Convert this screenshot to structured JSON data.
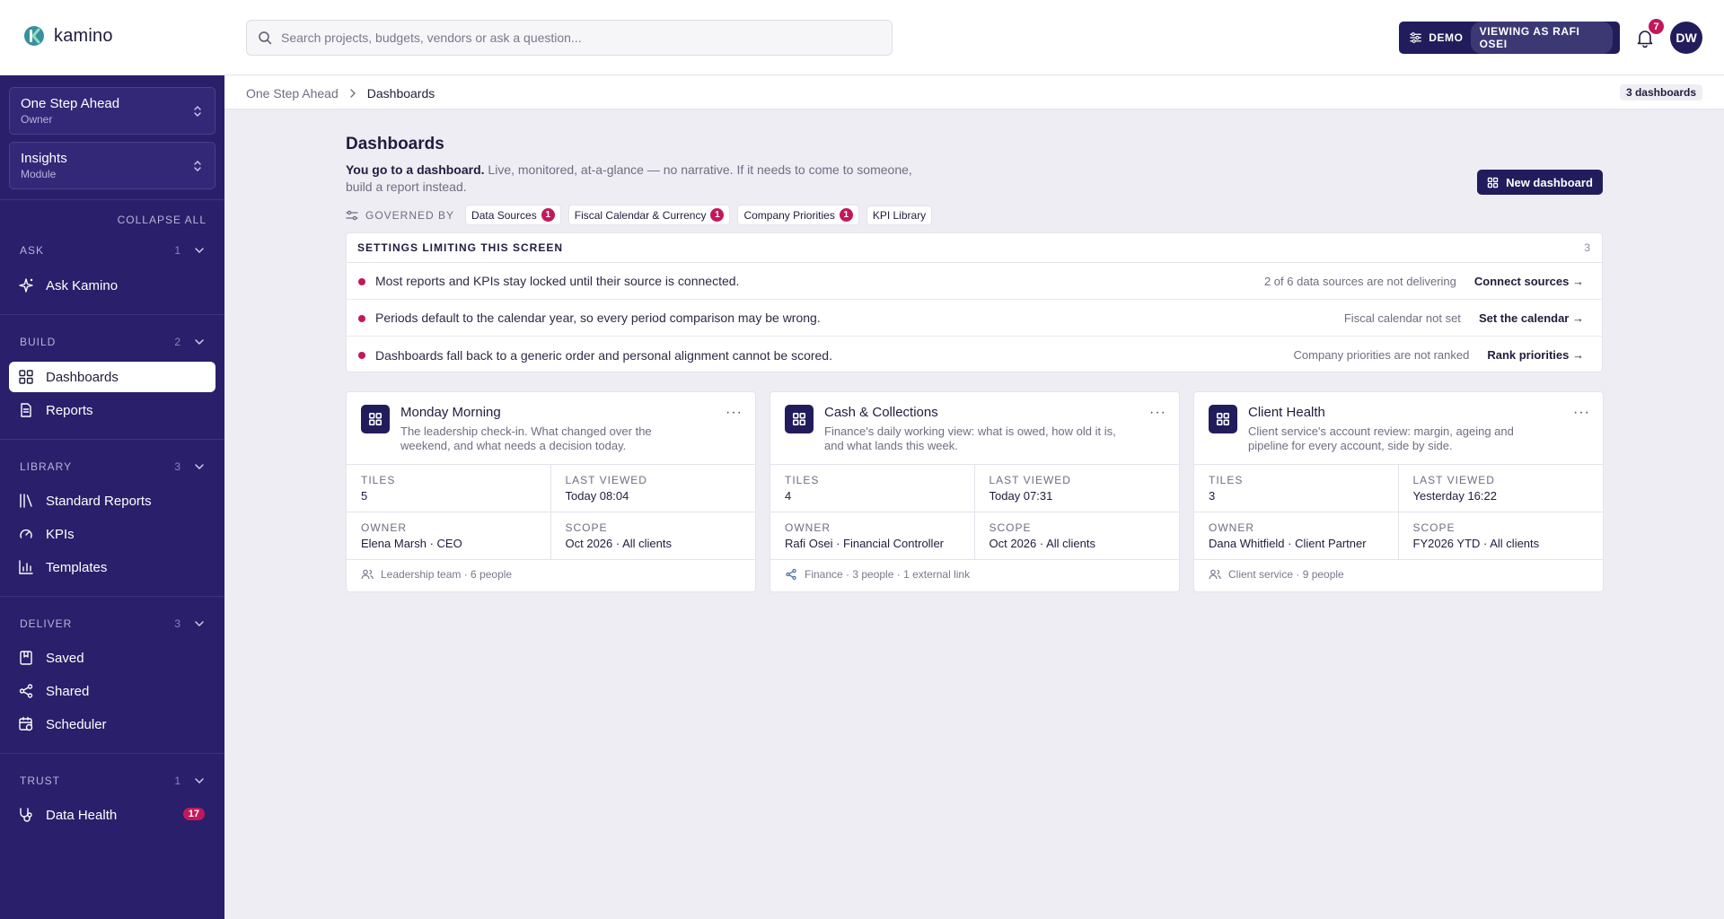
{
  "app": {
    "name": "kamino"
  },
  "search": {
    "placeholder": "Search projects, budgets, vendors or ask a question..."
  },
  "demo": {
    "label": "DEMO",
    "viewing": "VIEWING AS RAFI OSEI"
  },
  "notifications": {
    "count": "7"
  },
  "user": {
    "initials": "DW"
  },
  "sidebar": {
    "org": {
      "title": "One Step Ahead",
      "sub": "Owner"
    },
    "module": {
      "title": "Insights",
      "sub": "Module"
    },
    "collapse_all": "COLLAPSE ALL",
    "sections": {
      "ask": {
        "label": "ASK",
        "count": "1"
      },
      "build": {
        "label": "BUILD",
        "count": "2"
      },
      "library": {
        "label": "LIBRARY",
        "count": "3"
      },
      "deliver": {
        "label": "DELIVER",
        "count": "3"
      },
      "trust": {
        "label": "TRUST",
        "count": "1"
      }
    },
    "items": {
      "ask_kamino": "Ask Kamino",
      "dashboards": "Dashboards",
      "reports": "Reports",
      "standard_reports": "Standard Reports",
      "kpis": "KPIs",
      "templates": "Templates",
      "saved": "Saved",
      "shared": "Shared",
      "scheduler": "Scheduler",
      "data_health": "Data Health",
      "data_health_badge": "17"
    }
  },
  "breadcrumb": {
    "parent": "One Step Ahead",
    "current": "Dashboards",
    "count": "3 dashboards"
  },
  "page": {
    "title": "Dashboards",
    "lead": "You go to a dashboard.",
    "desc": " Live, monitored, at-a-glance — no narrative. If it needs to come to someone, build a report instead.",
    "new_button": "New dashboard"
  },
  "governed": {
    "label": "GOVERNED BY",
    "chips": [
      {
        "label": "Data Sources",
        "badge": "1"
      },
      {
        "label": "Fiscal Calendar & Currency",
        "badge": "1"
      },
      {
        "label": "Company Priorities",
        "badge": "1"
      },
      {
        "label": "KPI Library",
        "badge": ""
      }
    ]
  },
  "settings": {
    "title": "SETTINGS LIMITING THIS SCREEN",
    "count": "3",
    "rows": [
      {
        "text": "Most reports and KPIs stay locked until their source is connected.",
        "note": "2 of 6 data sources are not delivering",
        "link": "Connect sources"
      },
      {
        "text": "Periods default to the calendar year, so every period comparison may be wrong.",
        "note": "Fiscal calendar not set",
        "link": "Set the calendar"
      },
      {
        "text": "Dashboards fall back to a generic order and personal alignment cannot be scored.",
        "note": "Company priorities are not ranked",
        "link": "Rank priorities"
      }
    ]
  },
  "labels": {
    "tiles": "TILES",
    "last_viewed": "LAST VIEWED",
    "owner": "OWNER",
    "scope": "SCOPE",
    "more": "···"
  },
  "cards": [
    {
      "title": "Monday Morning",
      "desc": "The leadership check-in. What changed over the weekend, and what needs a decision today.",
      "tiles": "5",
      "last_viewed": "Today 08:04",
      "owner": "Elena Marsh · CEO",
      "scope": "Oct 2026 · All clients",
      "foot": "Leadership team · 6 people",
      "foot_icon": "people-icon"
    },
    {
      "title": "Cash & Collections",
      "desc": "Finance's daily working view: what is owed, how old it is, and what lands this week.",
      "tiles": "4",
      "last_viewed": "Today 07:31",
      "owner": "Rafi Osei · Financial Controller",
      "scope": "Oct 2026 · All clients",
      "foot": "Finance · 3 people · 1 external link",
      "foot_icon": "share-icon"
    },
    {
      "title": "Client Health",
      "desc": "Client service's account review: margin, ageing and pipeline for every account, side by side.",
      "tiles": "3",
      "last_viewed": "Yesterday 16:22",
      "owner": "Dana Whitfield · Client Partner",
      "scope": "FY2026 YTD · All clients",
      "foot": "Client service · 9 people",
      "foot_icon": "people-icon"
    }
  ],
  "colors": {
    "sidebar": "#2a1f6a",
    "primary": "#211d5c",
    "alert": "#c2185b",
    "background": "#eeedf4"
  }
}
